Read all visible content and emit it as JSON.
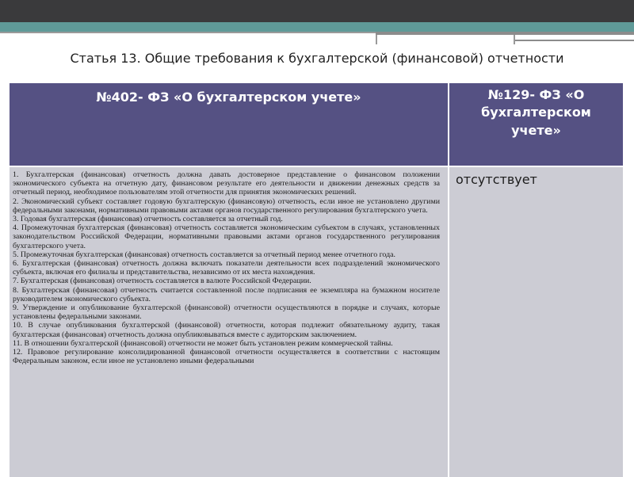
{
  "title": "Статья 13. Общие требования к бухгалтерской (финансовой) отчетности",
  "table": {
    "col1_header": "№402- ФЗ «О бухгалтерском учете»",
    "col2_header": "№129- ФЗ «О бухгалтерском учете»",
    "col2_body": "отсутствует",
    "col1_items": [
      "1. Бухгалтерская (финансовая) отчетность должна давать достоверное представление о финансовом положении экономического субъекта на отчетную дату, финансовом результате его деятельности и движении денежных средств за отчетный период, необходимое пользователям этой отчетности для принятия экономических решений.",
      "2. Экономический субъект составляет годовую бухгалтерскую (финансовую) отчетность, если иное не установлено другими федеральными законами, нормативными правовыми актами органов государственного регулирования бухгалтерского учета.",
      "3. Годовая бухгалтерская (финансовая) отчетность составляется за отчетный год.",
      "4. Промежуточная бухгалтерская (финансовая) отчетность составляется экономическим субъектом в случаях, установленных законодательством Российской Федерации, нормативными правовыми актами органов государственного регулирования бухгалтерского учета.",
      "5. Промежуточная бухгалтерская (финансовая) отчетность составляется за отчетный период менее отчетного года.",
      "6. Бухгалтерская (финансовая) отчетность должна включать показатели деятельности всех подразделений экономического субъекта, включая его филиалы и представительства, независимо от их места нахождения.",
      "7. Бухгалтерская (финансовая) отчетность составляется в валюте Российской Федерации.",
      "8. Бухгалтерская (финансовая) отчетность считается составленной после подписания ее экземпляра на бумажном носителе руководителем экономического субъекта.",
      "9. Утверждение и опубликование бухгалтерской (финансовой) отчетности осуществляются в порядке и случаях, которые установлены федеральными законами.",
      "10. В случае опубликования бухгалтерской (финансовой) отчетности, которая подлежит обязательному аудиту, такая бухгалтерская (финансовая) отчетность должна опубликовываться вместе с аудиторским заключением.",
      "11. В отношении бухгалтерской (финансовой) отчетности не может быть установлен режим коммерческой тайны.",
      "12. Правовое регулирование консолидированной финансовой отчетности осуществляется в соответствии с настоящим Федеральным законом, если иное не установлено иными федеральными"
    ]
  },
  "colors": {
    "top_band": "#3a3a3c",
    "accent_band": "#5f9a98",
    "header_bg": "#555183",
    "body_bg": "#ccccd4"
  }
}
